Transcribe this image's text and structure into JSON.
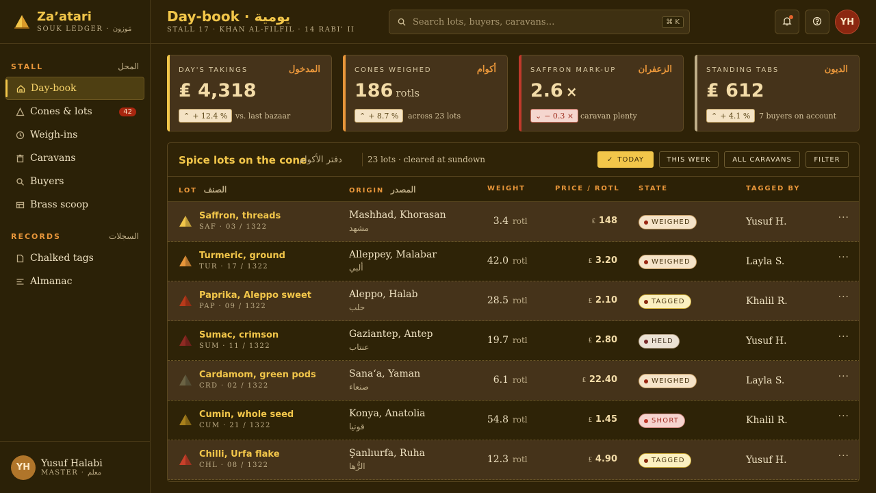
{
  "brand": {
    "name": "Za’atari",
    "sub": "SOUK LEDGER · مَوزون"
  },
  "sidebar": {
    "section1": {
      "label": "STALL",
      "ar": "المحل"
    },
    "items": [
      {
        "label": "Day-book",
        "icon": "home-icon"
      },
      {
        "label": "Cones & lots",
        "icon": "cone-icon",
        "badge": "42"
      },
      {
        "label": "Weigh-ins",
        "icon": "clock-icon"
      },
      {
        "label": "Caravans",
        "icon": "crate-icon"
      },
      {
        "label": "Buyers",
        "icon": "search-icon"
      },
      {
        "label": "Brass scoop",
        "icon": "scoop-icon"
      }
    ],
    "section2": {
      "label": "RECORDS",
      "ar": "السجلات"
    },
    "records": [
      {
        "label": "Chalked tags",
        "icon": "document-icon"
      },
      {
        "label": "Almanac",
        "icon": "list-icon"
      }
    ]
  },
  "user": {
    "initials": "YH",
    "name": "Yusuf Halabi",
    "role": "MASTER · معلم"
  },
  "header": {
    "title": "Day-book · يومية",
    "crumb": "STALL 17 · KHAN AL-FILFIL · 14 RABIʿ II",
    "search_placeholder": "Search lots, buyers, caravans…",
    "kbd": "⌘ K",
    "avatar": "YH"
  },
  "kpis": [
    {
      "label": "DAY'S TAKINGS",
      "ar": "المدخول",
      "value": "₤ 4,318",
      "unit": "",
      "delta": "+ 12.4 %",
      "dir": "up",
      "note": "vs. last bazaar",
      "accent": "#f2c64a"
    },
    {
      "label": "CONES WEIGHED",
      "ar": "أكوام",
      "value": "186",
      "unit": "rotls",
      "delta": "+ 8.7 %",
      "dir": "up",
      "note": "across 23 lots",
      "accent": "#e8963a"
    },
    {
      "label": "SAFFRON MARK-UP",
      "ar": "الزعفران",
      "value": "2.6",
      "unit": "×",
      "delta": "− 0.3 ×",
      "dir": "down",
      "note": "caravan plenty",
      "accent": "#c0392b"
    },
    {
      "label": "STANDING TABS",
      "ar": "الديون",
      "value": "₤ 612",
      "unit": "",
      "delta": "+ 4.1 %",
      "dir": "up",
      "note": "7 buyers on account",
      "accent": "#bfae88"
    }
  ],
  "table": {
    "title": "Spice lots on the cone",
    "title_ar": "دفتر الأكوام",
    "count": "23 lots · cleared at sundown",
    "filters": [
      "TODAY",
      "THIS WEEK",
      "ALL CARAVANS",
      "FILTER"
    ],
    "columns": {
      "lot": "LOT",
      "lot_ar": "الصنف",
      "origin": "ORIGIN",
      "origin_ar": "المصدر",
      "weight": "WEIGHT",
      "price": "PRICE / ROTL",
      "state": "STATE",
      "tagged": "TAGGED BY"
    },
    "currency": "₤",
    "unit": "rotl",
    "rows": [
      {
        "name": "Saffron, threads",
        "code": "SAF · 03 / 1322",
        "origin": "Mashhad, Khorasan",
        "origin_ar": "مشهد",
        "weight": "3.4",
        "price": "148",
        "state": "WEIGHED",
        "tagged": "Yusuf H.",
        "color": "#f2c64a"
      },
      {
        "name": "Turmeric, ground",
        "code": "TUR · 17 / 1322",
        "origin": "Alleppey, Malabar",
        "origin_ar": "ألبي",
        "weight": "42.0",
        "price": "3.20",
        "state": "WEIGHED",
        "tagged": "Layla S.",
        "color": "#e8963a"
      },
      {
        "name": "Paprika, Aleppo sweet",
        "code": "PAP · 09 / 1322",
        "origin": "Aleppo, Halab",
        "origin_ar": "حلب",
        "weight": "28.5",
        "price": "2.10",
        "state": "TAGGED",
        "tagged": "Khalil R.",
        "color": "#b83a1a"
      },
      {
        "name": "Sumac, crimson",
        "code": "SUM · 11 / 1322",
        "origin": "Gaziantep, Antep",
        "origin_ar": "عنتاب",
        "weight": "19.7",
        "price": "2.80",
        "state": "HELD",
        "tagged": "Yusuf H.",
        "color": "#8e2a22"
      },
      {
        "name": "Cardamom, green pods",
        "code": "CRD · 02 / 1322",
        "origin": "Sana‘a, Yaman",
        "origin_ar": "صنعاء",
        "weight": "6.1",
        "price": "22.40",
        "state": "WEIGHED",
        "tagged": "Layla S.",
        "color": "#6b6344"
      },
      {
        "name": "Cumin, whole seed",
        "code": "CUM · 21 / 1322",
        "origin": "Konya, Anatolia",
        "origin_ar": "قونيا",
        "weight": "54.8",
        "price": "1.45",
        "state": "SHORT",
        "tagged": "Khalil R.",
        "color": "#a8801c"
      },
      {
        "name": "Chilli, Urfa flake",
        "code": "CHL · 08 / 1322",
        "origin": "Şanlıurfa, Ruha",
        "origin_ar": "الرُّها",
        "weight": "12.3",
        "price": "4.90",
        "state": "TAGGED",
        "tagged": "Yusuf H.",
        "color": "#c8402a"
      }
    ]
  }
}
